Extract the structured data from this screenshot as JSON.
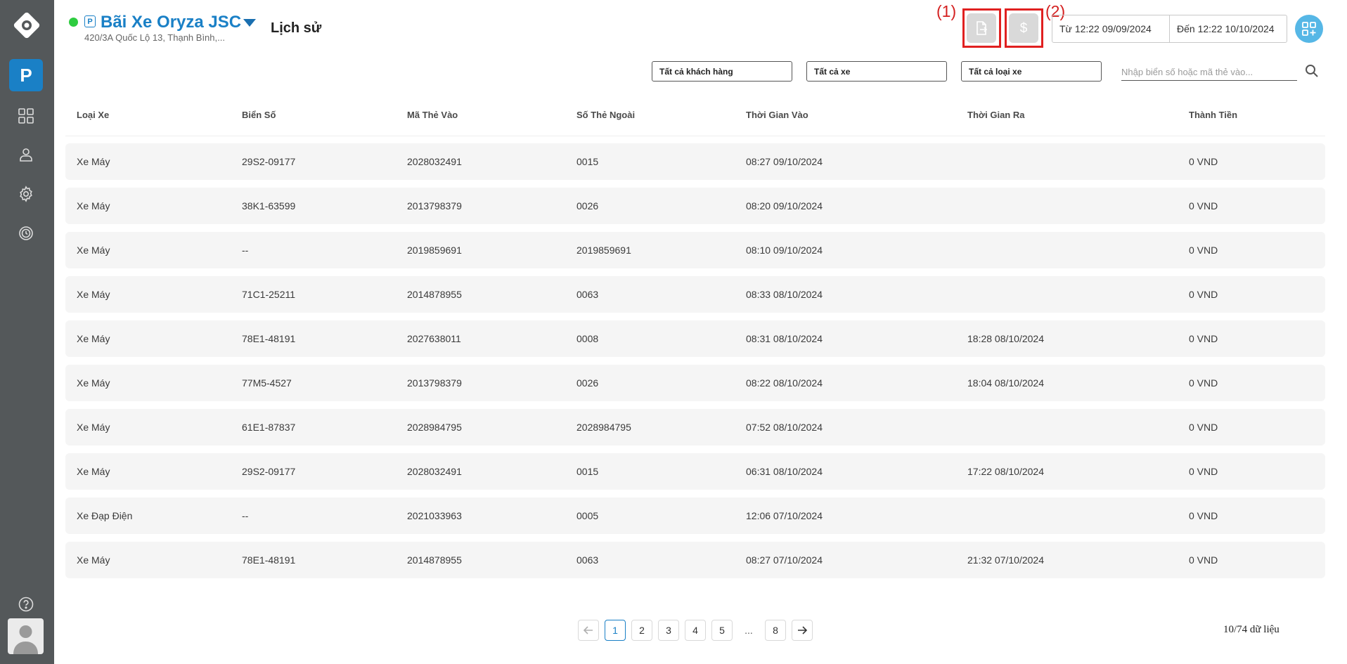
{
  "header": {
    "lot_name": "Bãi Xe Oryza JSC",
    "lot_address": "420/3A Quốc Lộ 13, Thạnh Bình,...",
    "page_title": "Lịch sử",
    "label_1": "(1)",
    "label_2": "(2)",
    "date_from": "Từ 12:22 09/09/2024",
    "date_to": "Đến 12:22 10/10/2024"
  },
  "sidebar": {
    "parking_label": "P"
  },
  "filters": {
    "customer": "Tất cả khách hàng",
    "vehicle": "Tất cả xe",
    "vehicle_type": "Tất cả loại xe",
    "search_placeholder": "Nhập biển số hoặc mã thẻ vào..."
  },
  "table": {
    "columns": [
      "Loại Xe",
      "Biển Số",
      "Mã Thẻ Vào",
      "Số Thẻ Ngoài",
      "Thời Gian Vào",
      "Thời Gian Ra",
      "Thành Tiền"
    ],
    "rows": [
      [
        "Xe Máy",
        "29S2-09177",
        "2028032491",
        "0015",
        "08:27 09/10/2024",
        "",
        "0 VND"
      ],
      [
        "Xe Máy",
        "38K1-63599",
        "2013798379",
        "0026",
        "08:20 09/10/2024",
        "",
        "0 VND"
      ],
      [
        "Xe Máy",
        "--",
        "2019859691",
        "2019859691",
        "08:10 09/10/2024",
        "",
        "0 VND"
      ],
      [
        "Xe Máy",
        "71C1-25211",
        "2014878955",
        "0063",
        "08:33 08/10/2024",
        "",
        "0 VND"
      ],
      [
        "Xe Máy",
        "78E1-48191",
        "2027638011",
        "0008",
        "08:31 08/10/2024",
        "18:28 08/10/2024",
        "0 VND"
      ],
      [
        "Xe Máy",
        "77M5-4527",
        "2013798379",
        "0026",
        "08:22 08/10/2024",
        "18:04 08/10/2024",
        "0 VND"
      ],
      [
        "Xe Máy",
        "61E1-87837",
        "2028984795",
        "2028984795",
        "07:52 08/10/2024",
        "",
        "0 VND"
      ],
      [
        "Xe Máy",
        "29S2-09177",
        "2028032491",
        "0015",
        "06:31 08/10/2024",
        "17:22 08/10/2024",
        "0 VND"
      ],
      [
        "Xe Đạp Điện",
        "--",
        "2021033963",
        "0005",
        "12:06 07/10/2024",
        "",
        "0 VND"
      ],
      [
        "Xe Máy",
        "78E1-48191",
        "2014878955",
        "0063",
        "08:27 07/10/2024",
        "21:32 07/10/2024",
        "0 VND"
      ]
    ]
  },
  "pagination": {
    "pages": [
      "1",
      "2",
      "3",
      "4",
      "5"
    ],
    "ellipsis": "...",
    "last_page": "8",
    "current": "1",
    "count_text": "10/74 dữ liệu"
  },
  "colors": {
    "sidebar_bg": "#54585a",
    "brand_blue": "#1a80c6",
    "status_online": "#2ecc40",
    "highlight_red": "#e02020",
    "row_bg": "#f5f5f5"
  },
  "icons": [
    "app-logo-icon",
    "parking-icon",
    "dashboard-icon",
    "user-icon",
    "settings-icon",
    "history-icon",
    "help-icon",
    "avatar-icon",
    "export-file-icon",
    "dollar-icon",
    "grid-add-icon",
    "search-icon",
    "arrow-left-icon",
    "arrow-right-icon"
  ]
}
